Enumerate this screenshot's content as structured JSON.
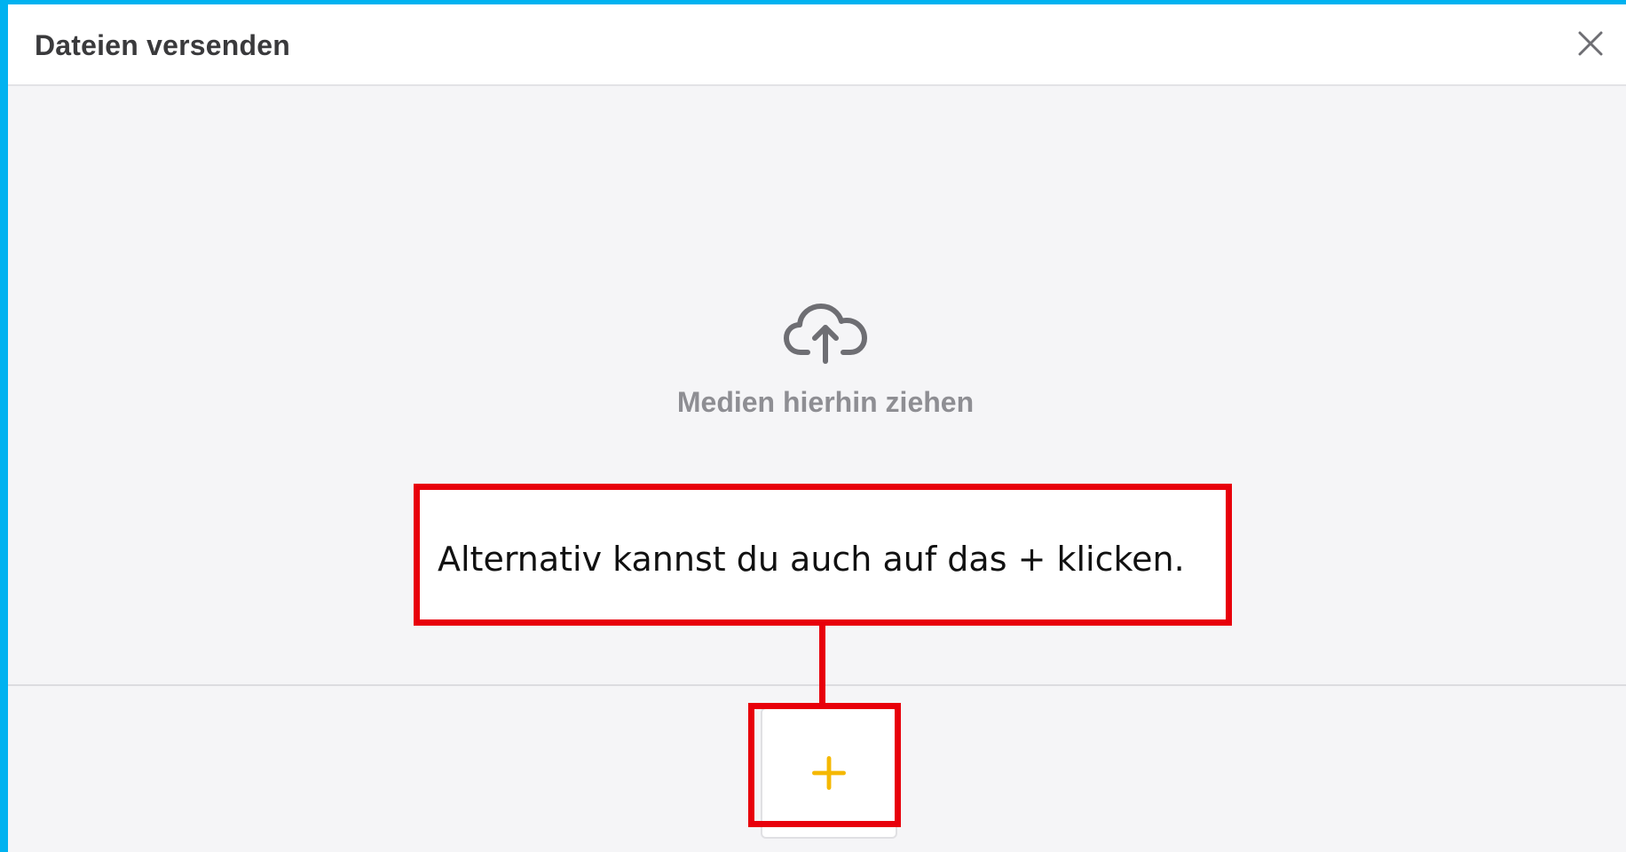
{
  "dialog": {
    "title": "Dateien versenden",
    "close_icon": "close-icon"
  },
  "drop_zone": {
    "icon": "cloud-upload-icon",
    "text": "Medien hierhin ziehen"
  },
  "add_button": {
    "icon": "plus-icon",
    "color": "#f5b800"
  },
  "annotation": {
    "text": "Alternativ kannst du auch auf das + klicken.",
    "color": "#e8000b"
  },
  "colors": {
    "frame": "#00b2f0",
    "background": "#f5f5f7",
    "icon_gray": "#6e6e73"
  }
}
